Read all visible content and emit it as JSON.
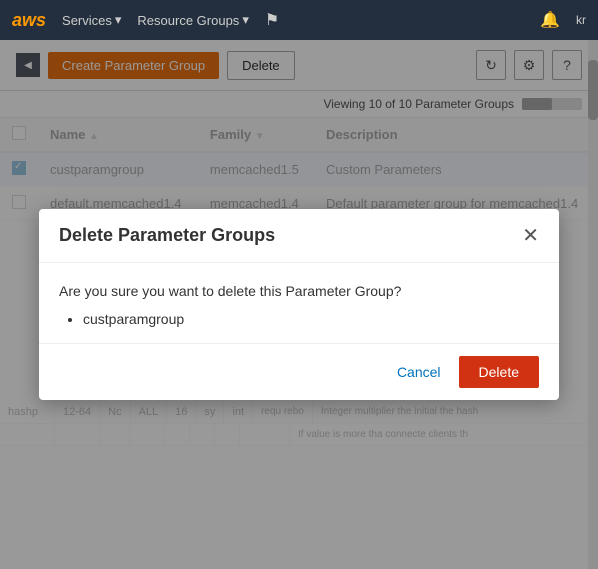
{
  "nav": {
    "logo": "aws",
    "services_label": "Services",
    "resource_groups_label": "Resource Groups",
    "chevron": "▾"
  },
  "toolbar": {
    "create_label": "Create Parameter Group",
    "delete_label": "Delete",
    "refresh_icon": "↻",
    "settings_icon": "⚙",
    "help_icon": "?"
  },
  "table_info": {
    "viewing_text": "Viewing 10 of 10 Parameter Groups"
  },
  "table": {
    "columns": [
      "Name",
      "Family",
      "Description"
    ],
    "rows": [
      {
        "selected": true,
        "name": "custparamgroup",
        "family": "memcached1.5",
        "description": "Custom Parameters"
      },
      {
        "selected": false,
        "name": "default.memcached1.4",
        "family": "memcached1.4",
        "description": "Default parameter group for memcached1.4"
      }
    ]
  },
  "modal": {
    "title": "Delete Parameter Groups",
    "body_text": "Are you sure you want to delete this Parameter Group?",
    "item_name": "custparamgroup",
    "cancel_label": "Cancel",
    "delete_label": "Delete",
    "close_icon": "✕"
  },
  "bg_table_rows": [
    {
      "cells": [
        "hashp",
        "12-64",
        "Nc",
        "ALL",
        "16",
        "sy",
        "int",
        "requ rebo",
        "Integer multiplier the initial the hash"
      ]
    },
    {
      "cells": [
        "",
        "",
        "",
        "",
        "",
        "",
        "",
        "",
        "If value is more tha connecte clients th"
      ]
    }
  ]
}
